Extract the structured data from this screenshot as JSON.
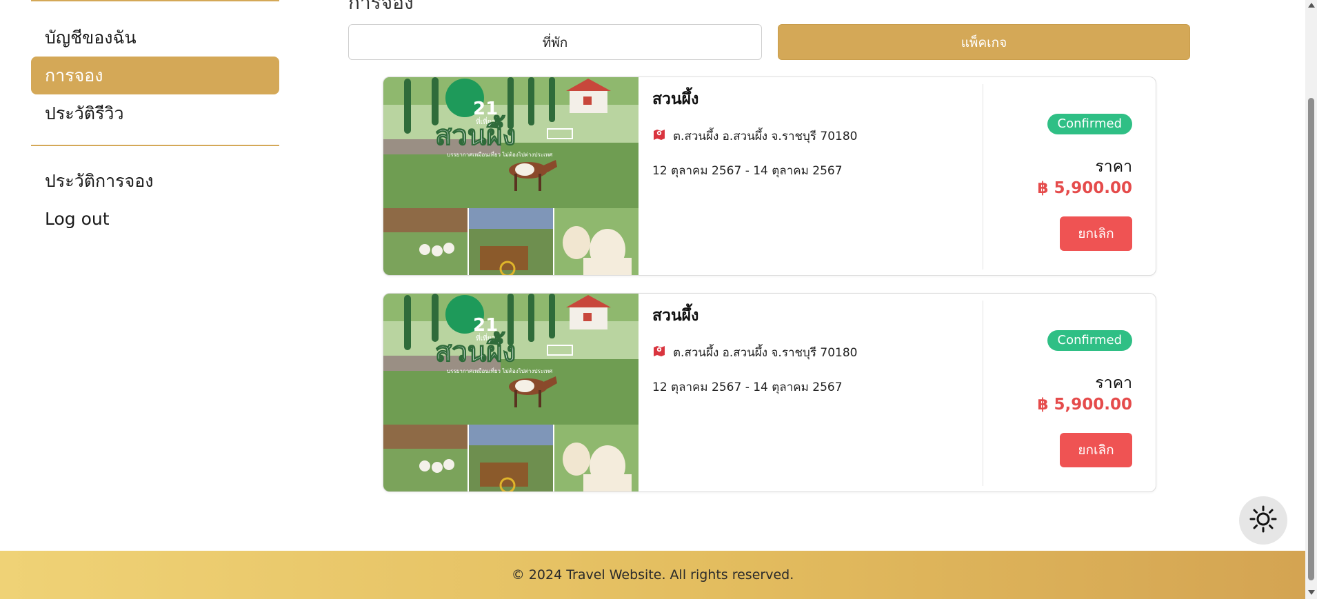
{
  "page": {
    "title": "การจอง"
  },
  "sidebar": {
    "items": [
      {
        "label": "บัญชีของฉัน",
        "active": false
      },
      {
        "label": "การจอง",
        "active": true
      },
      {
        "label": "ประวัติรีวิว",
        "active": false
      },
      {
        "label": "ประวัติการจอง",
        "active": false
      },
      {
        "label": "Log out",
        "active": false
      }
    ]
  },
  "tabs": [
    {
      "label": "ที่พัก",
      "active": false
    },
    {
      "label": "แพ็คเกจ",
      "active": true
    }
  ],
  "bookings": [
    {
      "name": "สวนผึ้ง",
      "location": "ต.สวนผึ้ง อ.สวนผึ้ง จ.ราชบุรี 70180",
      "dates": "12 ตุลาคม 2567 - 14 ตุลาคม 2567",
      "status": "Confirmed",
      "price_label": "ราคา",
      "price": "฿ 5,900.00",
      "cancel_label": "ยกเลิก",
      "image": {
        "badge_number": "21",
        "badge_sub": "ที่เที่ยว",
        "title": "สวนผึ้ง",
        "caption": "บรรยากาศเหมือนเที่ยว ไม่ต้องไปต่างประเทศ"
      }
    },
    {
      "name": "สวนผึ้ง",
      "location": "ต.สวนผึ้ง อ.สวนผึ้ง จ.ราชบุรี 70180",
      "dates": "12 ตุลาคม 2567 - 14 ตุลาคม 2567",
      "status": "Confirmed",
      "price_label": "ราคา",
      "price": "฿ 5,900.00",
      "cancel_label": "ยกเลิก",
      "image": {
        "badge_number": "21",
        "badge_sub": "ที่เที่ยว",
        "title": "สวนผึ้ง",
        "caption": "บรรยากาศเหมือนเที่ยว ไม่ต้องไปต่างประเทศ"
      }
    }
  ],
  "footer": {
    "text": "© 2024 Travel Website. All rights reserved."
  },
  "colors": {
    "accent": "#d4a857",
    "status_confirmed": "#2fbf85",
    "price": "#e54b4b",
    "cancel": "#ef5353",
    "location_icon": "#d9343e"
  },
  "icons": {
    "location": "map-pin-icon",
    "theme": "sun-icon"
  }
}
